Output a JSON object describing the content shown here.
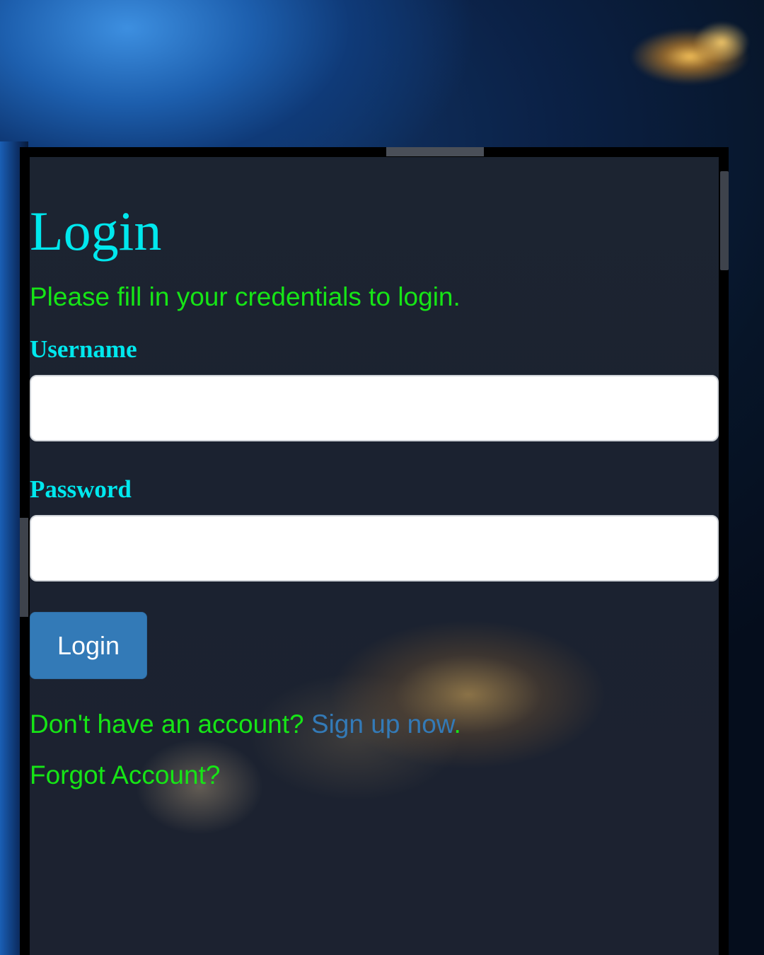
{
  "page": {
    "title": "Login",
    "subtitle": "Please fill in your credentials to login."
  },
  "form": {
    "username_label": "Username",
    "username_value": "",
    "password_label": "Password",
    "password_value": "",
    "submit_label": "Login"
  },
  "footer": {
    "signup_prompt": "Don't have an account?",
    "signup_link": "Sign up now",
    "signup_suffix": ".",
    "forgot_link": "Forgot Account?"
  },
  "colors": {
    "title": "#00e8ee",
    "text": "#16e516",
    "link": "#337ab7",
    "button": "#337ab7",
    "panel": "#1c2431"
  }
}
